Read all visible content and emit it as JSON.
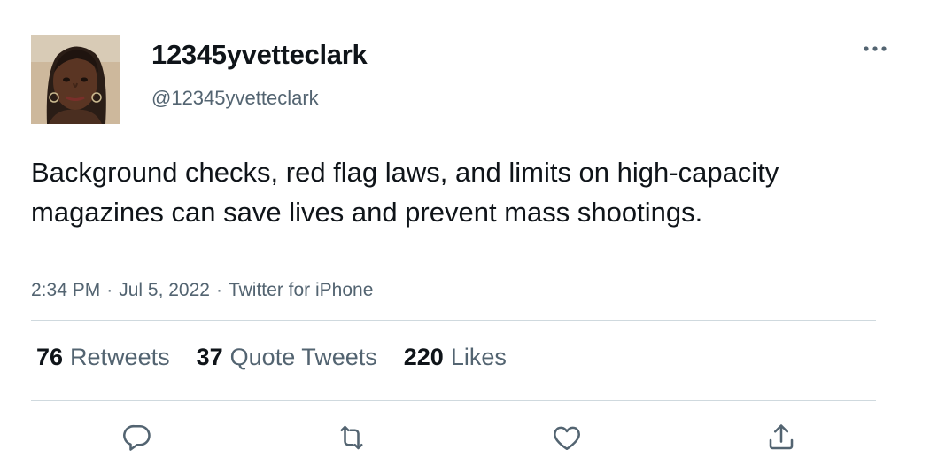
{
  "author": {
    "display_name": "12345yvetteclark",
    "handle": "@12345yvetteclark"
  },
  "tweet": {
    "text": "Background checks, red flag laws, and limits on high-capacity magazines can save lives and prevent mass shootings.",
    "time": "2:34 PM",
    "date": "Jul 5, 2022",
    "source": "Twitter for iPhone",
    "separator": "·"
  },
  "stats": {
    "retweets": {
      "count": "76",
      "label": "Retweets"
    },
    "quote_tweets": {
      "count": "37",
      "label": "Quote Tweets"
    },
    "likes": {
      "count": "220",
      "label": "Likes"
    }
  },
  "icons": {
    "more": "more-dots-icon",
    "reply": "reply-bubble-icon",
    "retweet": "retweet-arrows-icon",
    "like": "heart-icon",
    "share": "share-upload-icon"
  },
  "colors": {
    "text_primary": "#0f1419",
    "text_secondary": "#536471",
    "divider": "#cfd9de"
  }
}
